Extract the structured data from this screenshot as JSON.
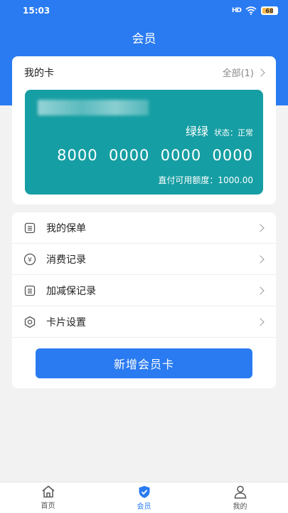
{
  "status_bar": {
    "time": "15:03",
    "signal": "HD",
    "battery": "68"
  },
  "header": {
    "title": "会员"
  },
  "card_section": {
    "label": "我的卡",
    "all_link": "全部(1)",
    "card": {
      "name": "绿绿",
      "status": "状态：正常",
      "number": "8000  0000  0000  0000",
      "limit": "直付可用额度：1000.00",
      "color": "#159ea3"
    }
  },
  "menu": [
    {
      "label": "我的保单",
      "icon": "document-icon"
    },
    {
      "label": "消费记录",
      "icon": "yen-circle-icon"
    },
    {
      "label": "加减保记录",
      "icon": "document-icon"
    },
    {
      "label": "卡片设置",
      "icon": "gear-icon"
    }
  ],
  "add_button": {
    "label": "新增会员卡"
  },
  "tabbar": {
    "tabs": [
      {
        "label": "首页",
        "icon": "home-icon",
        "active": false
      },
      {
        "label": "会员",
        "icon": "shield-check-icon",
        "active": true
      },
      {
        "label": "我的",
        "icon": "person-icon",
        "active": false
      }
    ]
  },
  "colors": {
    "primary": "#2a7bf1",
    "background": "#f2f2f2"
  }
}
